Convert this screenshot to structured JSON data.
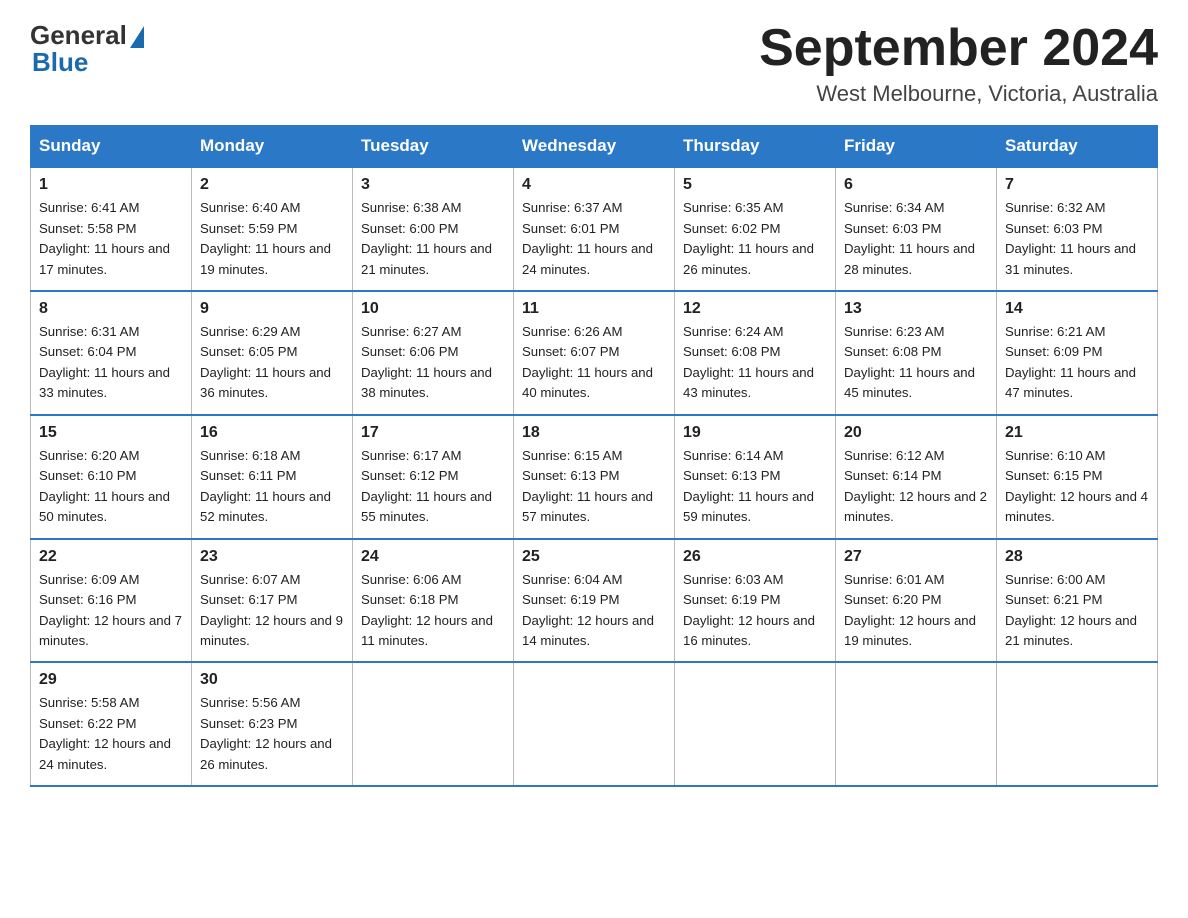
{
  "header": {
    "logo_general": "General",
    "logo_blue": "Blue",
    "month_year": "September 2024",
    "location": "West Melbourne, Victoria, Australia"
  },
  "weekdays": [
    "Sunday",
    "Monday",
    "Tuesday",
    "Wednesday",
    "Thursday",
    "Friday",
    "Saturday"
  ],
  "weeks": [
    [
      {
        "day": "1",
        "sunrise": "6:41 AM",
        "sunset": "5:58 PM",
        "daylight": "11 hours and 17 minutes."
      },
      {
        "day": "2",
        "sunrise": "6:40 AM",
        "sunset": "5:59 PM",
        "daylight": "11 hours and 19 minutes."
      },
      {
        "day": "3",
        "sunrise": "6:38 AM",
        "sunset": "6:00 PM",
        "daylight": "11 hours and 21 minutes."
      },
      {
        "day": "4",
        "sunrise": "6:37 AM",
        "sunset": "6:01 PM",
        "daylight": "11 hours and 24 minutes."
      },
      {
        "day": "5",
        "sunrise": "6:35 AM",
        "sunset": "6:02 PM",
        "daylight": "11 hours and 26 minutes."
      },
      {
        "day": "6",
        "sunrise": "6:34 AM",
        "sunset": "6:03 PM",
        "daylight": "11 hours and 28 minutes."
      },
      {
        "day": "7",
        "sunrise": "6:32 AM",
        "sunset": "6:03 PM",
        "daylight": "11 hours and 31 minutes."
      }
    ],
    [
      {
        "day": "8",
        "sunrise": "6:31 AM",
        "sunset": "6:04 PM",
        "daylight": "11 hours and 33 minutes."
      },
      {
        "day": "9",
        "sunrise": "6:29 AM",
        "sunset": "6:05 PM",
        "daylight": "11 hours and 36 minutes."
      },
      {
        "day": "10",
        "sunrise": "6:27 AM",
        "sunset": "6:06 PM",
        "daylight": "11 hours and 38 minutes."
      },
      {
        "day": "11",
        "sunrise": "6:26 AM",
        "sunset": "6:07 PM",
        "daylight": "11 hours and 40 minutes."
      },
      {
        "day": "12",
        "sunrise": "6:24 AM",
        "sunset": "6:08 PM",
        "daylight": "11 hours and 43 minutes."
      },
      {
        "day": "13",
        "sunrise": "6:23 AM",
        "sunset": "6:08 PM",
        "daylight": "11 hours and 45 minutes."
      },
      {
        "day": "14",
        "sunrise": "6:21 AM",
        "sunset": "6:09 PM",
        "daylight": "11 hours and 47 minutes."
      }
    ],
    [
      {
        "day": "15",
        "sunrise": "6:20 AM",
        "sunset": "6:10 PM",
        "daylight": "11 hours and 50 minutes."
      },
      {
        "day": "16",
        "sunrise": "6:18 AM",
        "sunset": "6:11 PM",
        "daylight": "11 hours and 52 minutes."
      },
      {
        "day": "17",
        "sunrise": "6:17 AM",
        "sunset": "6:12 PM",
        "daylight": "11 hours and 55 minutes."
      },
      {
        "day": "18",
        "sunrise": "6:15 AM",
        "sunset": "6:13 PM",
        "daylight": "11 hours and 57 minutes."
      },
      {
        "day": "19",
        "sunrise": "6:14 AM",
        "sunset": "6:13 PM",
        "daylight": "11 hours and 59 minutes."
      },
      {
        "day": "20",
        "sunrise": "6:12 AM",
        "sunset": "6:14 PM",
        "daylight": "12 hours and 2 minutes."
      },
      {
        "day": "21",
        "sunrise": "6:10 AM",
        "sunset": "6:15 PM",
        "daylight": "12 hours and 4 minutes."
      }
    ],
    [
      {
        "day": "22",
        "sunrise": "6:09 AM",
        "sunset": "6:16 PM",
        "daylight": "12 hours and 7 minutes."
      },
      {
        "day": "23",
        "sunrise": "6:07 AM",
        "sunset": "6:17 PM",
        "daylight": "12 hours and 9 minutes."
      },
      {
        "day": "24",
        "sunrise": "6:06 AM",
        "sunset": "6:18 PM",
        "daylight": "12 hours and 11 minutes."
      },
      {
        "day": "25",
        "sunrise": "6:04 AM",
        "sunset": "6:19 PM",
        "daylight": "12 hours and 14 minutes."
      },
      {
        "day": "26",
        "sunrise": "6:03 AM",
        "sunset": "6:19 PM",
        "daylight": "12 hours and 16 minutes."
      },
      {
        "day": "27",
        "sunrise": "6:01 AM",
        "sunset": "6:20 PM",
        "daylight": "12 hours and 19 minutes."
      },
      {
        "day": "28",
        "sunrise": "6:00 AM",
        "sunset": "6:21 PM",
        "daylight": "12 hours and 21 minutes."
      }
    ],
    [
      {
        "day": "29",
        "sunrise": "5:58 AM",
        "sunset": "6:22 PM",
        "daylight": "12 hours and 24 minutes."
      },
      {
        "day": "30",
        "sunrise": "5:56 AM",
        "sunset": "6:23 PM",
        "daylight": "12 hours and 26 minutes."
      },
      null,
      null,
      null,
      null,
      null
    ]
  ]
}
